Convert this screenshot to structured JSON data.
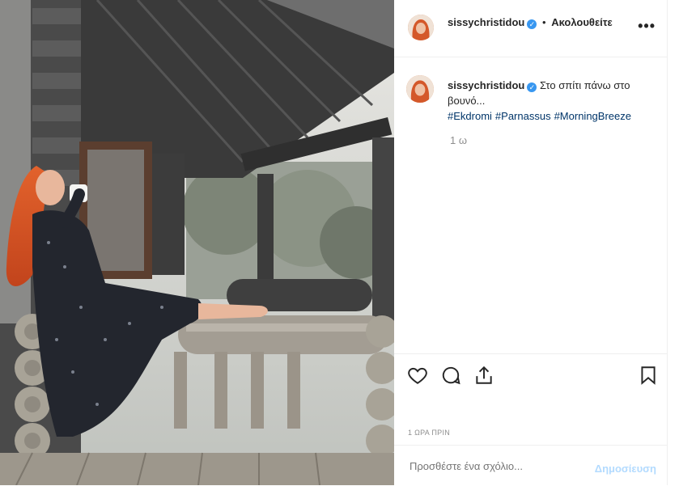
{
  "post": {
    "username": "sissychristidou",
    "verified": true,
    "follow_separator": "•",
    "follow_label": "Ακολουθείτε",
    "more_label": "•••",
    "caption": {
      "text": "Στο σπίτι πάνω στο βουνό...",
      "hashtags": [
        "#Ekdromi",
        "#Parnassus",
        "#MorningBreeze"
      ]
    },
    "caption_time": "1 ω",
    "time_ago": "1 ΩΡΑ ΠΡΙΝ",
    "comment_placeholder": "Προσθέστε ένα σχόλιο...",
    "post_button": "Δημοσίευση"
  },
  "icons": {
    "like": "heart-icon",
    "comment": "comment-bubble-icon",
    "share": "share-icon",
    "save": "bookmark-icon",
    "verified": "verified-badge-icon",
    "more": "more-options-icon"
  },
  "colors": {
    "link": "#003569",
    "verified": "#3897f0",
    "post_disabled": "#b3dbff",
    "muted": "#8e8e8e",
    "text": "#262626"
  }
}
